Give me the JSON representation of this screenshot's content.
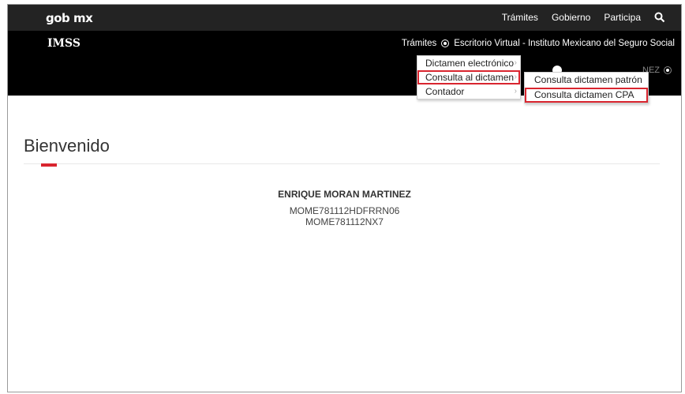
{
  "topbar": {
    "brand": "gob mx",
    "nav": [
      "Trámites",
      "Gobierno",
      "Participa"
    ]
  },
  "imss": {
    "logo": "IMSS",
    "nav_tramites": "Trámites",
    "nav_escritorio": "Escritorio Virtual - Instituto Mexicano del Seguro Social",
    "user_partial": "NEZ"
  },
  "dropdown": {
    "items": [
      "Dictamen electrónico",
      "Consulta al dictamen",
      "Contador"
    ]
  },
  "submenu": {
    "items": [
      "Consulta dictamen patrón",
      "Consulta dictamen CPA"
    ]
  },
  "main": {
    "title": "Bienvenido",
    "user_name": "ENRIQUE MORAN MARTINEZ",
    "curp": "MOME781112HDFRRN06",
    "rfc": "MOME781112NX7"
  },
  "colors": {
    "accent": "#d9252f",
    "topbar": "#232323",
    "imssbar": "#000000"
  }
}
